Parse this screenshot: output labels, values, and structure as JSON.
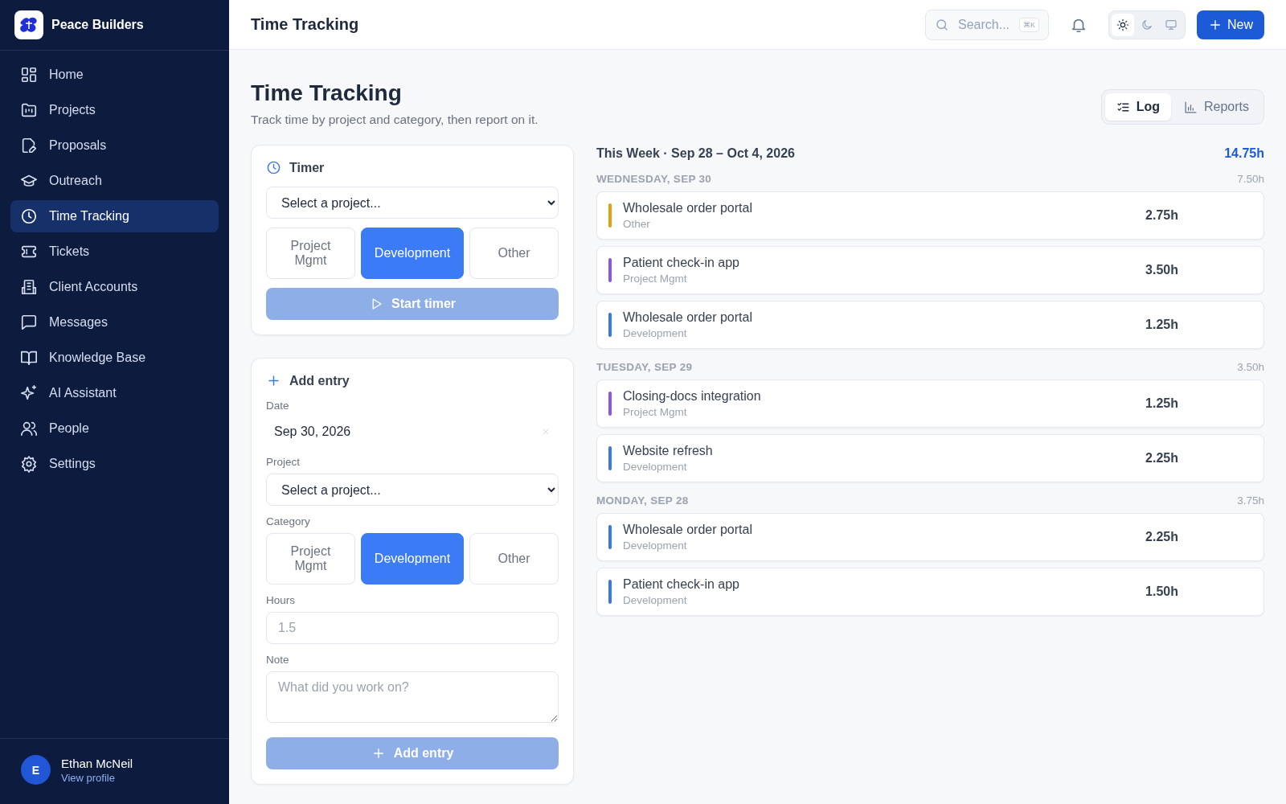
{
  "brand": {
    "name": "Peace Builders"
  },
  "sidebar": {
    "items": [
      {
        "label": "Home",
        "selected": false
      },
      {
        "label": "Projects",
        "selected": false
      },
      {
        "label": "Proposals",
        "selected": false
      },
      {
        "label": "Outreach",
        "selected": false
      },
      {
        "label": "Time Tracking",
        "selected": true
      },
      {
        "label": "Tickets",
        "selected": false
      },
      {
        "label": "Client Accounts",
        "selected": false
      },
      {
        "label": "Messages",
        "selected": false
      },
      {
        "label": "Knowledge Base",
        "selected": false
      },
      {
        "label": "AI Assistant",
        "selected": false
      },
      {
        "label": "People",
        "selected": false
      },
      {
        "label": "Settings",
        "selected": false
      }
    ]
  },
  "user": {
    "initial": "E",
    "name": "Ethan McNeil",
    "link": "View profile"
  },
  "header": {
    "title": "Time Tracking",
    "search": {
      "placeholder": "Search...",
      "shortcut": "⌘K"
    },
    "theme": [
      {
        "kind": "light",
        "selected": true
      },
      {
        "kind": "dark",
        "selected": false
      },
      {
        "kind": "system",
        "selected": false
      }
    ],
    "new_button": "New"
  },
  "page": {
    "title": "Time Tracking",
    "subtitle": "Track time by project and category, then report on it.",
    "tabs": [
      {
        "label": "Log",
        "selected": true
      },
      {
        "label": "Reports",
        "selected": false
      }
    ]
  },
  "timer": {
    "title": "Timer",
    "project": "Select a project...",
    "categories": [
      {
        "label": "Project Mgmt",
        "selected": false
      },
      {
        "label": "Development",
        "selected": true
      },
      {
        "label": "Other",
        "selected": false
      }
    ],
    "button": "Start timer",
    "disabled": true
  },
  "add_entry": {
    "title": "Add entry",
    "date_label": "Date",
    "date": "Sep 30, 2026",
    "project_label": "Project",
    "project": "Select a project...",
    "category_label": "Category",
    "categories": [
      {
        "label": "Project Mgmt",
        "selected": false
      },
      {
        "label": "Development",
        "selected": true
      },
      {
        "label": "Other",
        "selected": false
      }
    ],
    "hours_label": "Hours",
    "hours_placeholder": "1.5",
    "note_label": "Note",
    "note_placeholder": "What did you work on?",
    "button": "Add entry",
    "disabled": true
  },
  "week": {
    "title": "This Week · Sep 28 – Oct 4, 2026",
    "total": "14.75h",
    "days": [
      {
        "label": "WEDNESDAY, SEP 30",
        "total": "7.50h",
        "entries": [
          {
            "project": "Wholesale order portal",
            "category": "Other",
            "hours": "2.75h",
            "color": "#e5a010"
          },
          {
            "project": "Patient check-in app",
            "category": "Project Mgmt",
            "hours": "3.50h",
            "color": "#8b55e6"
          },
          {
            "project": "Wholesale order portal",
            "category": "Development",
            "hours": "1.25h",
            "color": "#3b78e7"
          }
        ]
      },
      {
        "label": "TUESDAY, SEP 29",
        "total": "3.50h",
        "entries": [
          {
            "project": "Closing-docs integration",
            "category": "Project Mgmt",
            "hours": "1.25h",
            "color": "#8b55e6"
          },
          {
            "project": "Website refresh",
            "category": "Development",
            "hours": "2.25h",
            "color": "#3b78e7"
          }
        ]
      },
      {
        "label": "MONDAY, SEP 28",
        "total": "3.75h",
        "entries": [
          {
            "project": "Wholesale order portal",
            "category": "Development",
            "hours": "2.25h",
            "color": "#3b78e7"
          },
          {
            "project": "Patient check-in app",
            "category": "Development",
            "hours": "1.50h",
            "color": "#3b78e7"
          }
        ]
      }
    ]
  }
}
